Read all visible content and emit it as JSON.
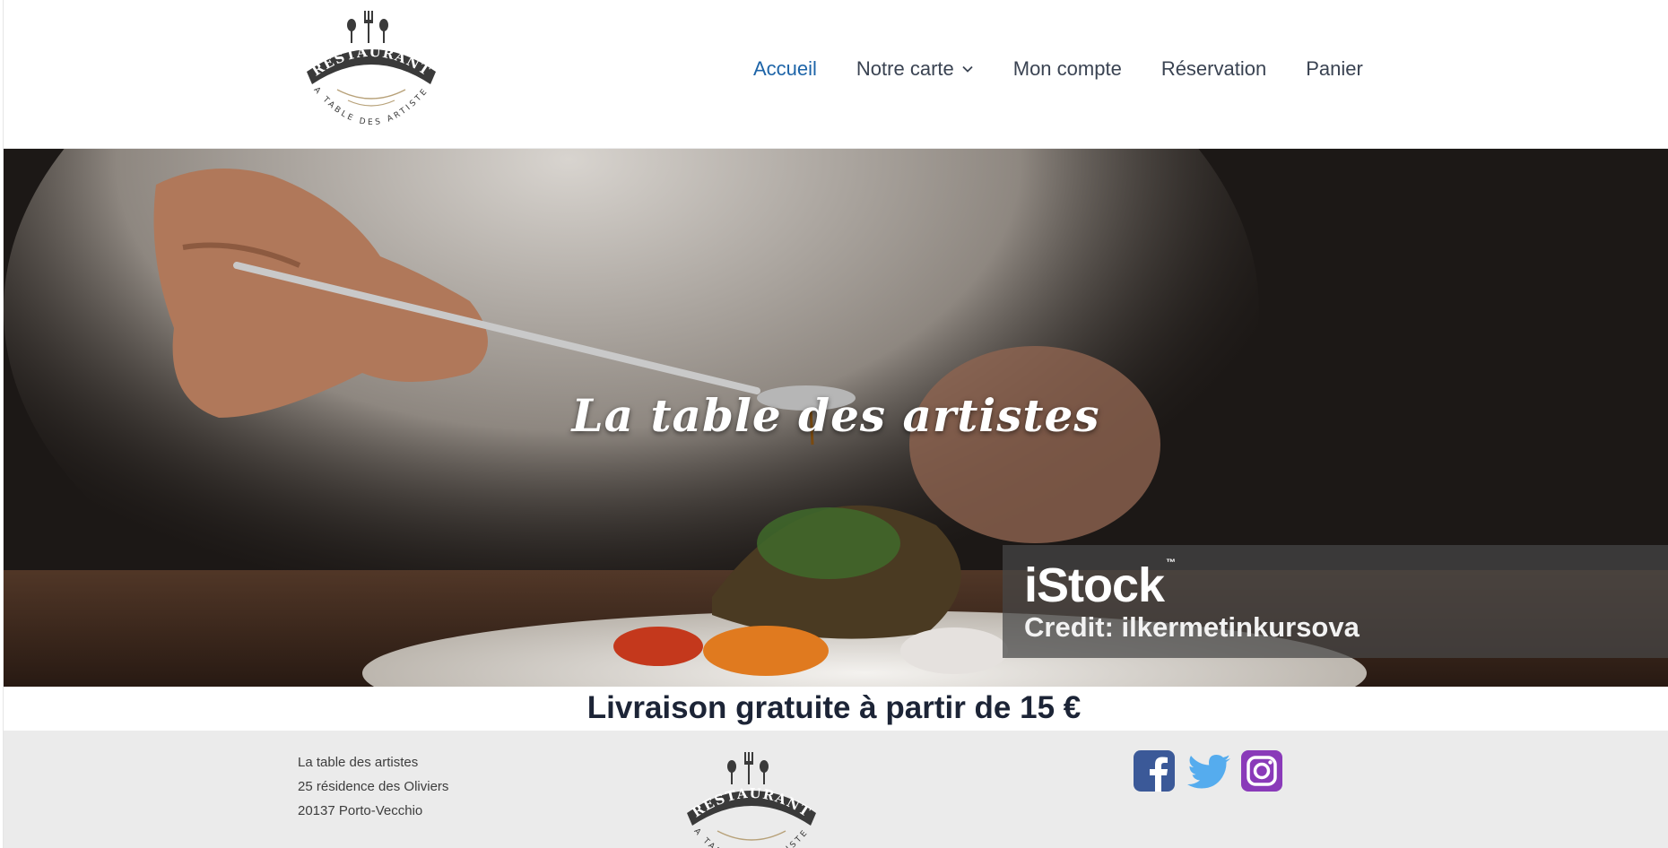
{
  "header": {
    "logo": {
      "top_text": "RESTAURANT",
      "bottom_text": "LA TABLE DES ARTISTES"
    },
    "nav": [
      {
        "label": "Accueil",
        "active": true
      },
      {
        "label": "Notre carte",
        "has_dropdown": true
      },
      {
        "label": "Mon compte"
      },
      {
        "label": "Réservation"
      },
      {
        "label": "Panier"
      }
    ]
  },
  "hero": {
    "title": "La table des artistes",
    "watermark": {
      "brand": "iStock",
      "tm": "™",
      "credit": "Credit: ilkermetinkursova"
    }
  },
  "promo": {
    "text": "Livraison gratuite à partir de 15 €"
  },
  "footer": {
    "address": [
      "La table des artistes",
      "25 résidence des Oliviers",
      "20137 Porto-Vecchio"
    ],
    "socials": [
      {
        "name": "facebook-icon",
        "color": "#3b5998"
      },
      {
        "name": "twitter-icon",
        "color": "#55acee"
      },
      {
        "name": "instagram-icon",
        "color": "#8a3ab9"
      }
    ]
  },
  "colors": {
    "nav_active": "#1d64a8",
    "nav": "#3a4352",
    "promo": "#1c2436",
    "footer_bg": "#ebebeb"
  }
}
